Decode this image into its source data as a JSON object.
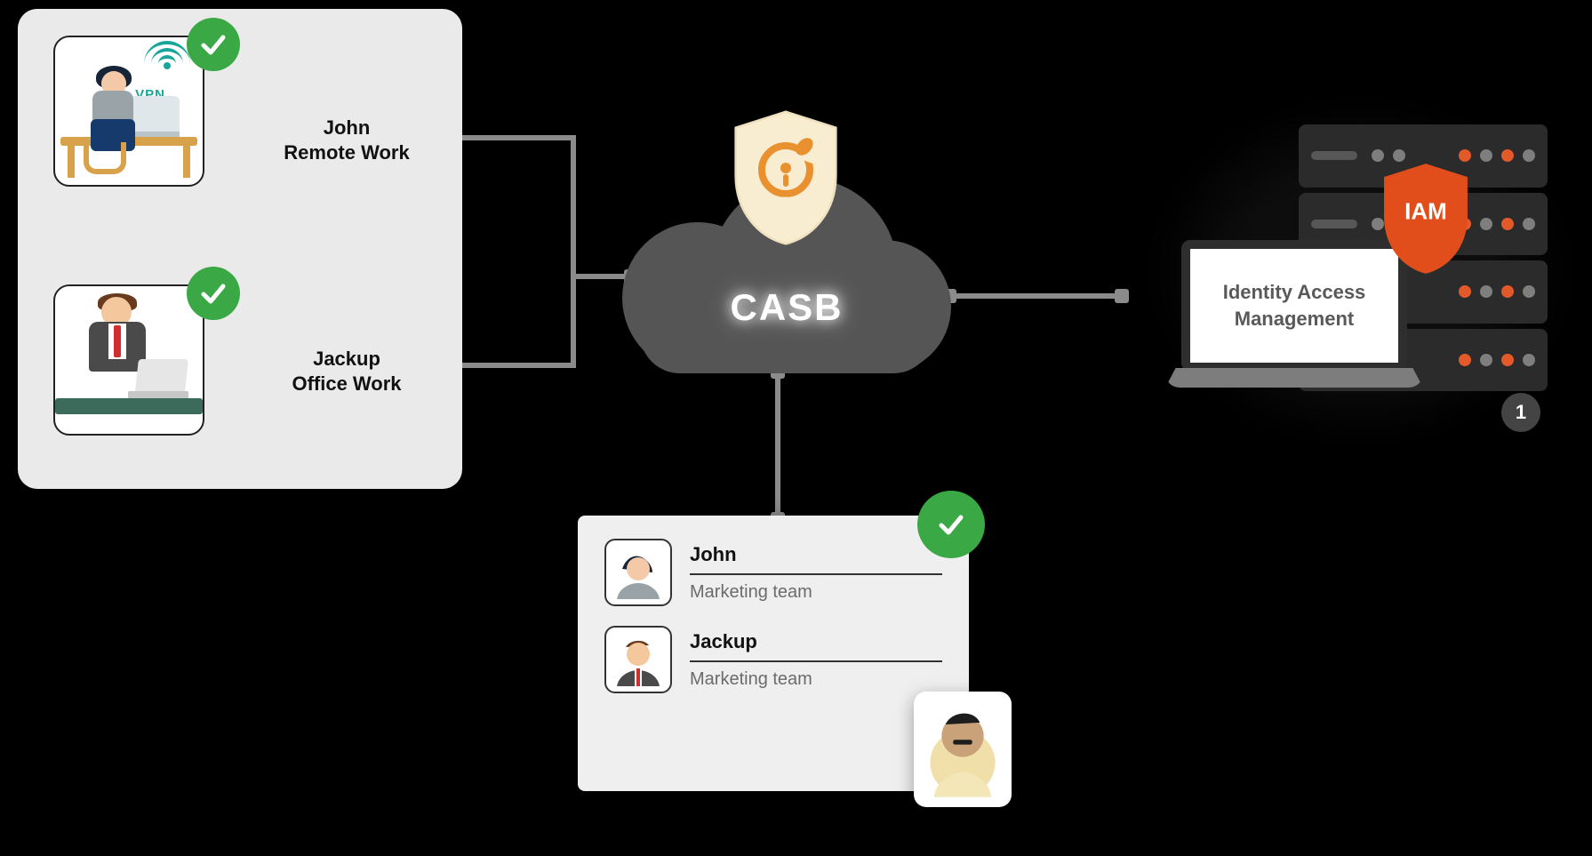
{
  "left": {
    "user1": {
      "name": "John",
      "mode": "Remote Work",
      "vpn_label": "VPN"
    },
    "user2": {
      "name": "Jackup",
      "mode": "Office Work"
    }
  },
  "casb": {
    "label": "CASB"
  },
  "iam": {
    "label_line1": "Identity Access",
    "label_line2": "Management",
    "shield_label": "IAM",
    "badge": "1"
  },
  "team": {
    "member1": {
      "name": "John",
      "role": "Marketing team"
    },
    "member2": {
      "name": "Jackup",
      "role": "Marketing team"
    }
  },
  "colors": {
    "check_green": "#39a845",
    "accent_orange": "#e9902f",
    "iam_shield": "#e24e1b"
  }
}
